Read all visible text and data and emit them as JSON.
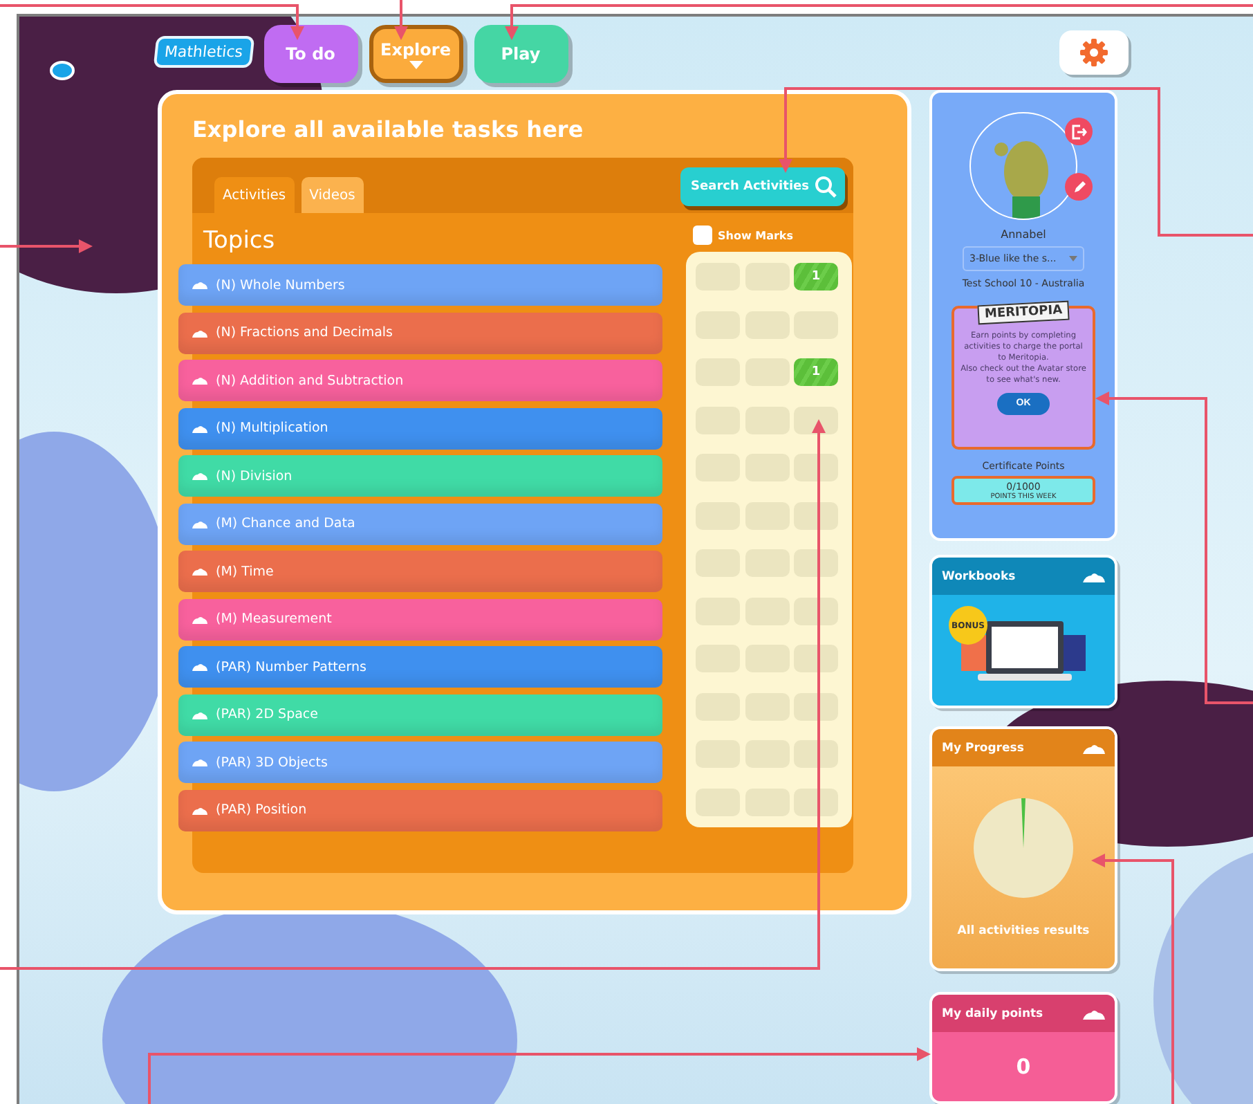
{
  "nav": {
    "logo": "Mathletics",
    "items": [
      {
        "label": "To do",
        "selected": false,
        "color": "#c06cf2"
      },
      {
        "label": "Explore",
        "selected": true,
        "color": "#fbab3c"
      },
      {
        "label": "Play",
        "selected": false,
        "color": "#45d6a4"
      }
    ]
  },
  "explore": {
    "title": "Explore all available tasks here",
    "tabs": [
      {
        "label": "Activities",
        "selected": true
      },
      {
        "label": "Videos",
        "selected": false
      }
    ],
    "search_button": "Search Activities",
    "show_marks": {
      "label": "Show Marks",
      "checked": false
    },
    "topics_title": "Topics",
    "topics": [
      {
        "label": "(N) Whole Numbers",
        "color": "#6ea4f5"
      },
      {
        "label": "(N) Fractions and Decimals",
        "color": "#eb6e4c"
      },
      {
        "label": "(N) Addition and Subtraction",
        "color": "#f8619d"
      },
      {
        "label": "(N) Multiplication",
        "color": "#3f90ef"
      },
      {
        "label": "(N) Division",
        "color": "#40dba6"
      },
      {
        "label": "(M) Chance and Data",
        "color": "#6ea4f5"
      },
      {
        "label": "(M) Time",
        "color": "#eb6e4c"
      },
      {
        "label": "(M) Measurement",
        "color": "#f8619d"
      },
      {
        "label": "(PAR) Number Patterns",
        "color": "#3f90ef"
      },
      {
        "label": "(PAR) 2D Space",
        "color": "#40dba6"
      },
      {
        "label": "(PAR) 3D Objects",
        "color": "#6ea4f5"
      },
      {
        "label": "(PAR) Position",
        "color": "#eb6e4c"
      }
    ],
    "marks": [
      [
        {
          "done": false
        },
        {
          "done": false
        },
        {
          "done": true,
          "score": "1"
        }
      ],
      [
        {
          "done": false
        },
        {
          "done": false
        },
        {
          "done": false
        }
      ],
      [
        {
          "done": false
        },
        {
          "done": false
        },
        {
          "done": true,
          "score": "1"
        }
      ],
      [
        {
          "done": false
        },
        {
          "done": false
        },
        {
          "done": false
        }
      ],
      [
        {
          "done": false
        },
        {
          "done": false
        },
        {
          "done": false
        }
      ],
      [
        {
          "done": false
        },
        {
          "done": false
        },
        {
          "done": false
        }
      ],
      [
        {
          "done": false
        },
        {
          "done": false
        },
        {
          "done": false
        }
      ],
      [
        {
          "done": false
        },
        {
          "done": false
        },
        {
          "done": false
        }
      ],
      [
        {
          "done": false
        },
        {
          "done": false
        },
        {
          "done": false
        }
      ],
      [
        {
          "done": false
        },
        {
          "done": false
        },
        {
          "done": false
        }
      ],
      [
        {
          "done": false
        },
        {
          "done": false
        },
        {
          "done": false
        }
      ],
      [
        {
          "done": false
        },
        {
          "done": false
        },
        {
          "done": false
        }
      ]
    ]
  },
  "profile": {
    "name": "Annabel",
    "class_select": "3-Blue like the s...",
    "school": "Test School 10 - Australia",
    "meritopia": {
      "logo": "MERITOPIA",
      "text": "Earn points by completing activities to charge the portal to Meritopia.\nAlso check out the Avatar store to see what's new.",
      "button": "OK"
    },
    "certificate_label": "Certificate Points",
    "points": "0/1000",
    "points_caption": "POINTS THIS WEEK"
  },
  "workbooks": {
    "title": "Workbooks",
    "badge": "BONUS"
  },
  "progress": {
    "title": "My Progress",
    "caption": "All activities results"
  },
  "daily_points": {
    "title": "My daily points",
    "value": "0"
  }
}
